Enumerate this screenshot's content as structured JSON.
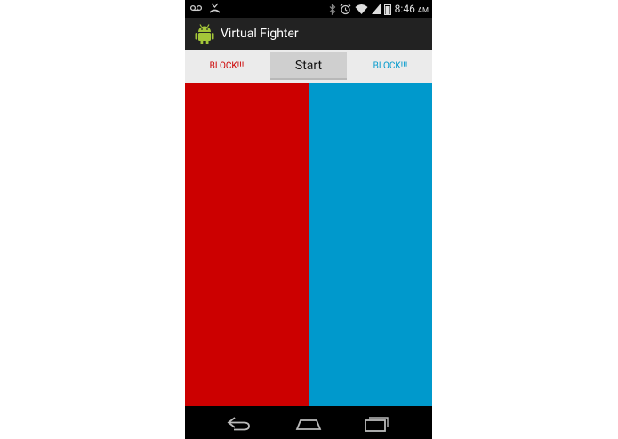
{
  "status_bar": {
    "time": "8:46",
    "ampm": "AM",
    "icons": [
      "voicemail-icon",
      "missed-call-icon",
      "bluetooth-icon",
      "alarm-icon",
      "wifi-icon",
      "signal-icon",
      "battery-icon"
    ]
  },
  "action_bar": {
    "title": "Virtual Fighter",
    "icon": "android-robot-icon"
  },
  "controls": {
    "left_block_label": "BLOCK!!!",
    "start_label": "Start",
    "right_block_label": "BLOCK!!!"
  },
  "colors": {
    "left_fighter": "#cc0000",
    "right_fighter": "#0099cc",
    "android_green": "#a4c639"
  },
  "nav_bar": {
    "icons": [
      "back-icon",
      "home-icon",
      "recent-apps-icon"
    ]
  }
}
